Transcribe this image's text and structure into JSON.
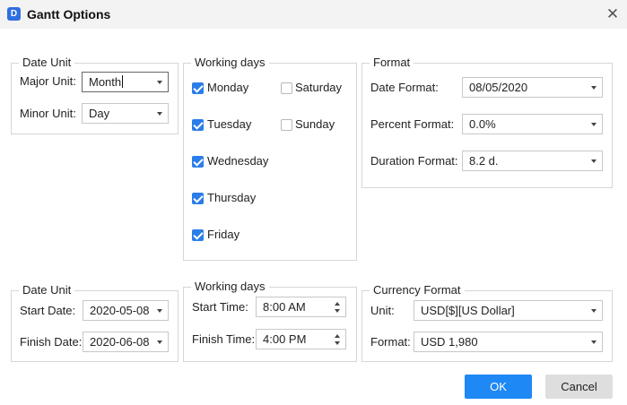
{
  "window": {
    "title": "Gantt Options",
    "icon": "D",
    "close": "✕"
  },
  "date_unit_1": {
    "legend": "Date Unit",
    "major_label": "Major Unit:",
    "major_value": "Month",
    "minor_label": "Minor Unit:",
    "minor_value": "Day"
  },
  "working_days_1": {
    "legend": "Working days",
    "days": [
      {
        "label": "Monday",
        "checked": true
      },
      {
        "label": "Tuesday",
        "checked": true
      },
      {
        "label": "Wednesday",
        "checked": true
      },
      {
        "label": "Thursday",
        "checked": true
      },
      {
        "label": "Friday",
        "checked": true
      },
      {
        "label": "Saturday",
        "checked": false
      },
      {
        "label": "Sunday",
        "checked": false
      }
    ]
  },
  "format": {
    "legend": "Format",
    "date_label": "Date Format:",
    "date_value": "08/05/2020",
    "percent_label": "Percent Format:",
    "percent_value": "0.0%",
    "duration_label": "Duration Format:",
    "duration_value": "8.2 d."
  },
  "date_unit_2": {
    "legend": "Date Unit",
    "start_label": "Start Date:",
    "start_value": "2020-05-08",
    "finish_label": "Finish Date:",
    "finish_value": "2020-06-08"
  },
  "working_days_2": {
    "legend": "Working days",
    "start_label": "Start Time:",
    "start_value": "8:00 AM",
    "finish_label": "Finish Time:",
    "finish_value": "4:00 PM"
  },
  "currency": {
    "legend": "Currency Format",
    "unit_label": "Unit:",
    "unit_value": "USD[$][US Dollar]",
    "format_label": "Format:",
    "format_value": "USD 1,980"
  },
  "buttons": {
    "ok": "OK",
    "cancel": "Cancel"
  },
  "colors": {
    "accent": "#1e88f5",
    "checkbox": "#2b7de9",
    "titlebar": "#f3f3f3"
  }
}
